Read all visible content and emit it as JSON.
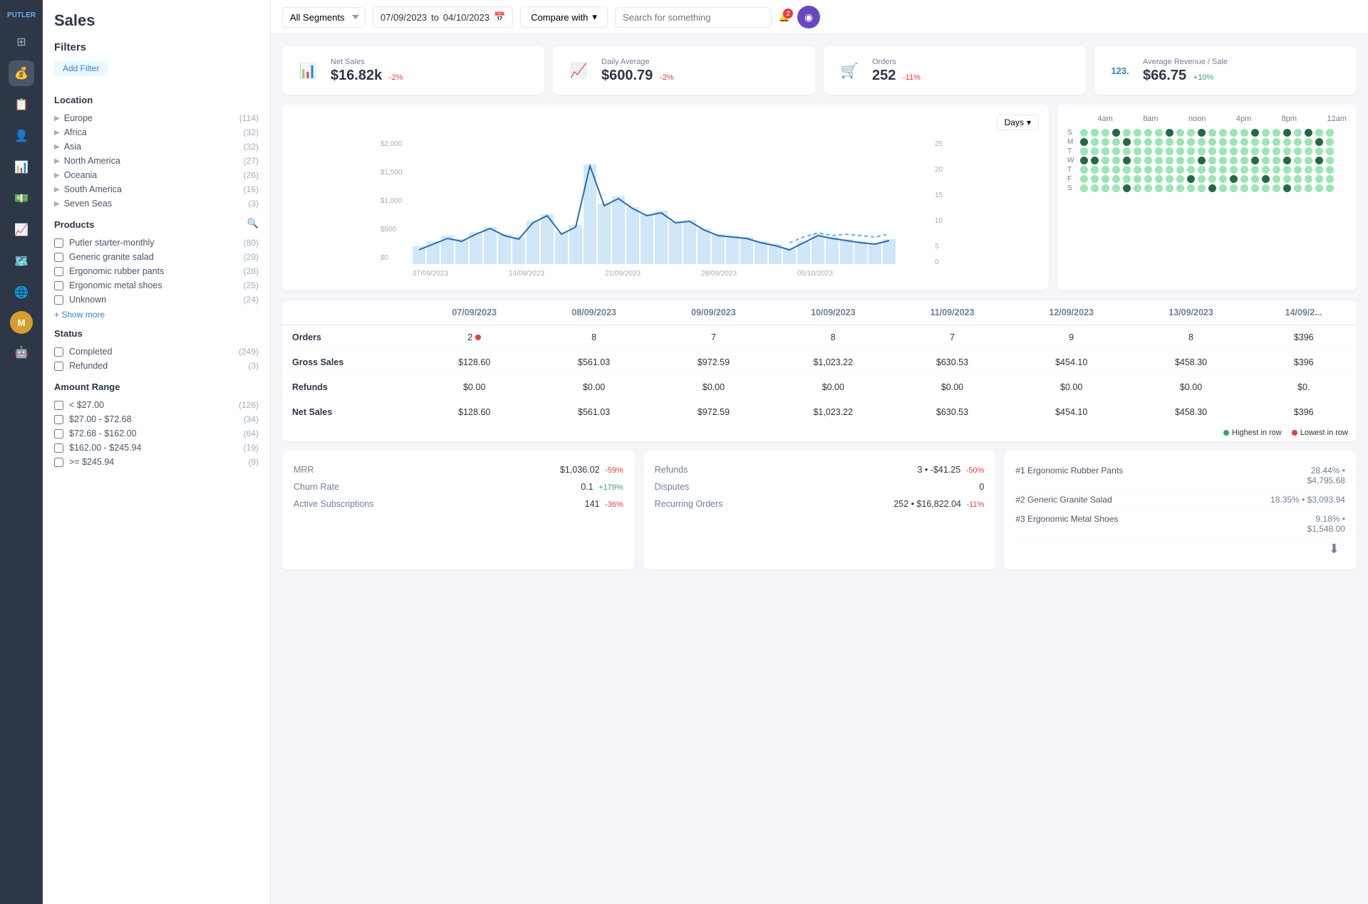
{
  "app": {
    "name": "PUTLER",
    "title": "Sales"
  },
  "topbar": {
    "segment_value": "All Segments",
    "date_from": "07/09/2023",
    "date_to": "04/10/2023",
    "compare_label": "Compare with",
    "search_placeholder": "Search for something",
    "notification_count": "2"
  },
  "kpis": [
    {
      "id": "net-sales",
      "label": "Net Sales",
      "value": "$16.82k",
      "change": "-2%",
      "change_type": "negative",
      "icon": "📊"
    },
    {
      "id": "daily-average",
      "label": "Daily Average",
      "value": "$600.79",
      "change": "-2%",
      "change_type": "negative",
      "icon": "📈"
    },
    {
      "id": "orders",
      "label": "Orders",
      "value": "252",
      "change": "-11%",
      "change_type": "negative",
      "icon": "🛒"
    },
    {
      "id": "avg-revenue",
      "label": "Average Revenue / Sale",
      "value": "$66.75",
      "change": "+10%",
      "change_type": "positive",
      "icon": "123"
    }
  ],
  "chart": {
    "days_label": "Days",
    "x_labels": [
      "07/09/2023",
      "14/09/2023",
      "21/09/2023",
      "28/09/2023",
      "05/10/2023"
    ],
    "y_labels": [
      "$2,000",
      "$1,500",
      "$1,000",
      "$500",
      "$0"
    ],
    "y_right_labels": [
      "25",
      "20",
      "15",
      "10",
      "5",
      "0"
    ]
  },
  "heatmap": {
    "time_labels": [
      "4am",
      "8am",
      "noon",
      "4pm",
      "8pm",
      "12am"
    ],
    "days": [
      "S",
      "M",
      "T",
      "W",
      "T",
      "F",
      "S"
    ]
  },
  "table": {
    "row_label_col": "",
    "columns": [
      "07/09/2023",
      "08/09/2023",
      "09/09/2023",
      "10/09/2023",
      "11/09/2023",
      "12/09/2023",
      "13/09/2023",
      "14/09/2..."
    ],
    "rows": [
      {
        "label": "Orders",
        "values": [
          "2",
          "8",
          "7",
          "8",
          "7",
          "9",
          "8",
          "$396"
        ],
        "has_dot": true
      },
      {
        "label": "Gross Sales",
        "values": [
          "$128.60",
          "$561.03",
          "$972.59",
          "$1,023.22",
          "$630.53",
          "$454.10",
          "$458.30",
          "$396"
        ]
      },
      {
        "label": "Refunds",
        "values": [
          "$0.00",
          "$0.00",
          "$0.00",
          "$0.00",
          "$0.00",
          "$0.00",
          "$0.00",
          "$0."
        ]
      },
      {
        "label": "Net Sales",
        "values": [
          "$128.60",
          "$561.03",
          "$972.59",
          "$1,023.22",
          "$630.53",
          "$454.10",
          "$458.30",
          "$396"
        ]
      }
    ],
    "legend_highest": "Highest in row",
    "legend_lowest": "Lowest in row"
  },
  "filters": {
    "title": "Filters",
    "add_filter_label": "Add Filter",
    "location_title": "Location",
    "locations": [
      {
        "name": "Europe",
        "count": 114
      },
      {
        "name": "Africa",
        "count": 32
      },
      {
        "name": "Asia",
        "count": 32
      },
      {
        "name": "North America",
        "count": 27
      },
      {
        "name": "Oceania",
        "count": 26
      },
      {
        "name": "South America",
        "count": 16
      },
      {
        "name": "Seven Seas",
        "count": 3
      }
    ],
    "products_title": "Products",
    "products": [
      {
        "name": "Putler starter-monthly",
        "count": 80
      },
      {
        "name": "Generic granite salad",
        "count": 29
      },
      {
        "name": "Ergonomic rubber pants",
        "count": 28
      },
      {
        "name": "Ergonomic metal shoes",
        "count": 25
      },
      {
        "name": "Unknown",
        "count": 24
      }
    ],
    "show_more_label": "+ Show more",
    "status_title": "Status",
    "statuses": [
      {
        "name": "Completed",
        "count": 249
      },
      {
        "name": "Refunded",
        "count": 3
      }
    ],
    "amount_title": "Amount Range",
    "amounts": [
      {
        "label": "< $27.00",
        "count": 126
      },
      {
        "label": "$27.00 - $72.68",
        "count": 34
      },
      {
        "label": "$72.68 - $162.00",
        "count": 64
      },
      {
        "label": "$162.00 - $245.94",
        "count": 19
      },
      {
        "label": ">= $245.94",
        "count": 9
      }
    ]
  },
  "stats_left": {
    "rows": [
      {
        "label": "MRR",
        "value": "$1,036.02",
        "change": "-59%",
        "change_type": "neg"
      },
      {
        "label": "Churn Rate",
        "value": "0.1",
        "change": "+179%",
        "change_type": "pos"
      },
      {
        "label": "Active Subscriptions",
        "value": "141",
        "change": "-36%",
        "change_type": "neg"
      }
    ]
  },
  "stats_mid": {
    "rows": [
      {
        "label": "Refunds",
        "value": "3 • -$41.25",
        "change": "-50%",
        "change_type": "neg"
      },
      {
        "label": "Disputes",
        "value": "0",
        "change": "",
        "change_type": ""
      },
      {
        "label": "Recurring Orders",
        "value": "252 • $16,822.04",
        "change": "-11%",
        "change_type": "neg"
      }
    ]
  },
  "top_products": [
    {
      "rank": "#1",
      "name": "Ergonomic Rubber Pants",
      "pct": "28.44%",
      "value": "$4,795.68"
    },
    {
      "rank": "#2",
      "name": "Generic Granite Salad",
      "pct": "18.35%",
      "value": "$3,093.94"
    },
    {
      "rank": "#3",
      "name": "Ergonomic Metal Shoes",
      "pct": "9.18%",
      "value": "$1,548.00"
    }
  ],
  "sidebar_items": [
    {
      "id": "dashboard",
      "icon": "⊞",
      "active": false
    },
    {
      "id": "sales",
      "icon": "💰",
      "active": true
    },
    {
      "id": "orders",
      "icon": "📋",
      "active": false
    },
    {
      "id": "customers",
      "icon": "👤",
      "active": false
    },
    {
      "id": "reports",
      "icon": "📊",
      "active": false
    },
    {
      "id": "revenue",
      "icon": "💵",
      "active": false
    },
    {
      "id": "analytics",
      "icon": "📈",
      "active": false
    },
    {
      "id": "map",
      "icon": "🗺️",
      "active": false
    },
    {
      "id": "globe",
      "icon": "🌐",
      "active": false
    },
    {
      "id": "user-m",
      "icon": "M",
      "active": false
    },
    {
      "id": "user-robot",
      "icon": "🤖",
      "active": false
    }
  ]
}
